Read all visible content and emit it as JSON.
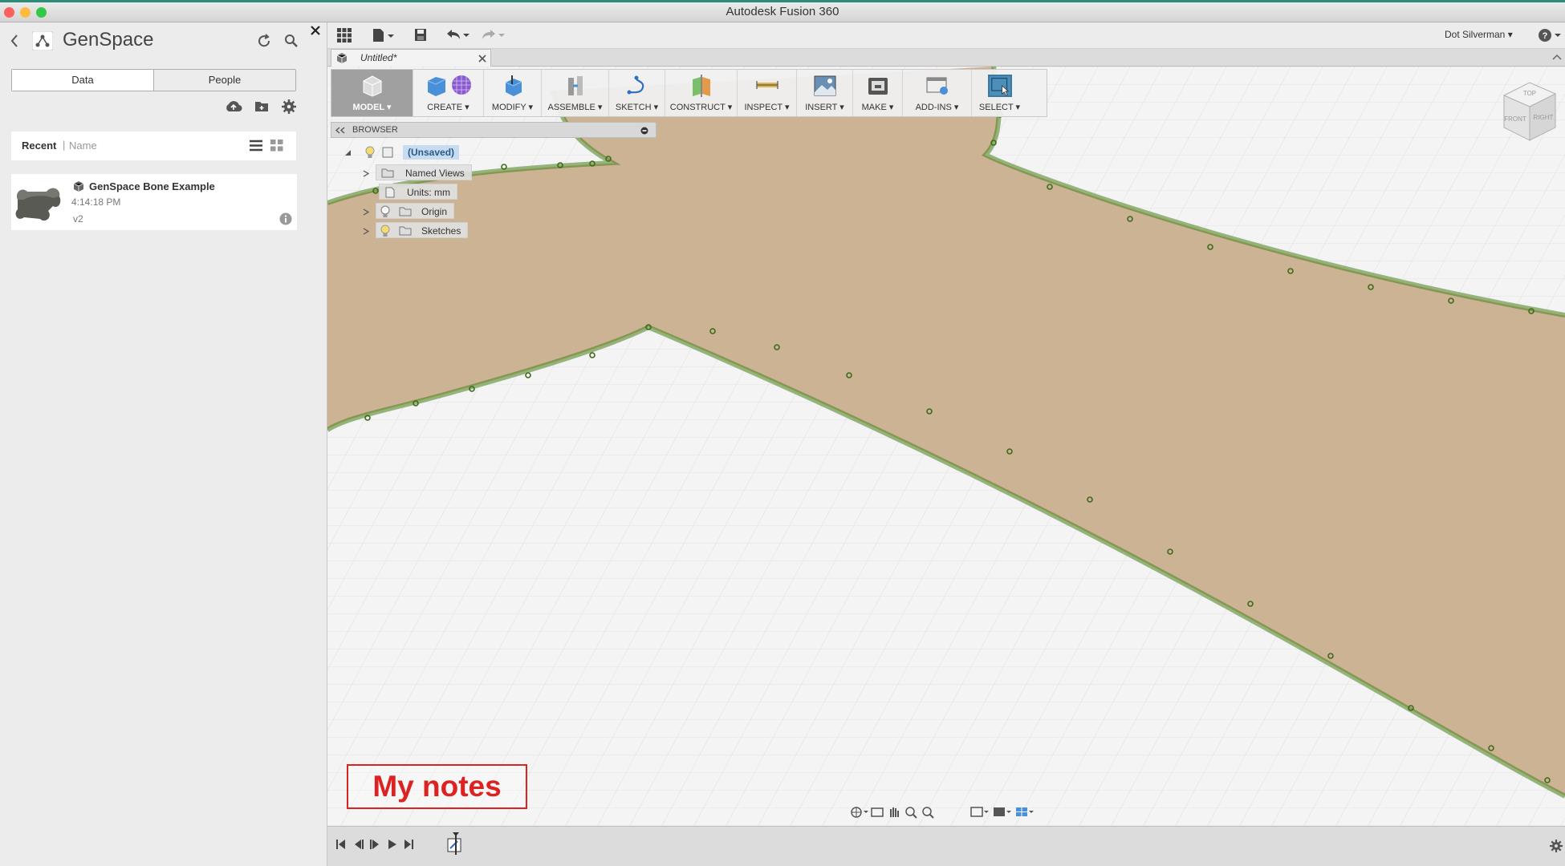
{
  "window": {
    "title": "Autodesk Fusion 360"
  },
  "left_panel": {
    "title": "GenSpace",
    "tabs": [
      "Data",
      "People"
    ],
    "recent_label": "Recent",
    "name_label": "Name",
    "item": {
      "name": "GenSpace Bone Example",
      "time": "4:14:18 PM",
      "version": "v2"
    }
  },
  "topbar": {
    "user": "Dot Silverman ▾",
    "help": "?"
  },
  "document_tab": {
    "label": "Untitled*"
  },
  "toolbar": {
    "items": [
      "MODEL ▾",
      "CREATE ▾",
      "MODIFY ▾",
      "ASSEMBLE ▾",
      "SKETCH ▾",
      "CONSTRUCT ▾",
      "INSPECT ▾",
      "INSERT ▾",
      "MAKE ▾",
      "ADD-INS ▾",
      "SELECT ▾"
    ]
  },
  "browser": {
    "label": "BROWSER",
    "root": "(Unsaved)",
    "items": [
      "Named Views",
      "Units: mm",
      "Origin",
      "Sketches"
    ]
  },
  "viewcube": {
    "top": "TOP",
    "front": "FRONT",
    "right": "RIGHT"
  },
  "notes": {
    "label": "My notes"
  },
  "colors": {
    "accent": "#4d8fb8",
    "sketch_fill": "#c8b08e",
    "sketch_line": "#4d7a2a",
    "notes_red": "#d22222"
  }
}
